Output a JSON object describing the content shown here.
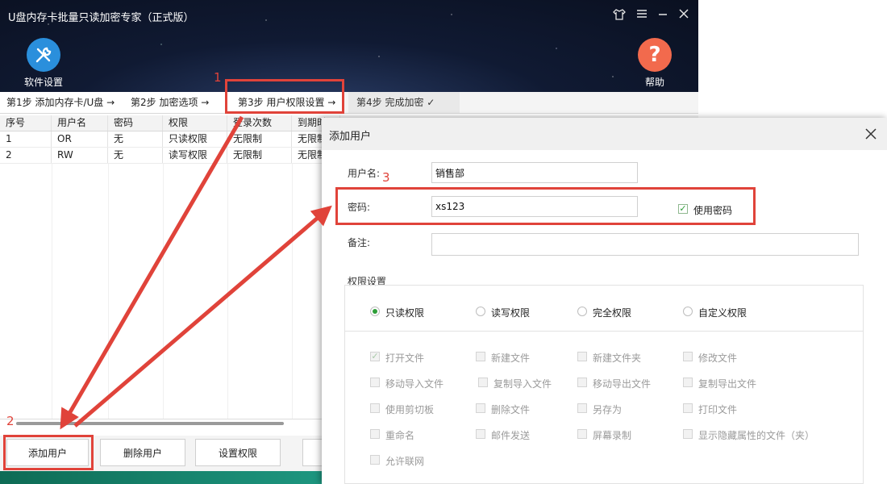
{
  "app": {
    "title": "U盘内存卡批量只读加密专家（正式版）",
    "window_buttons": [
      "skin-icon",
      "menu-icon",
      "minimize-icon",
      "close-icon"
    ]
  },
  "toolbar": {
    "settings_label": "软件设置",
    "settings_icon": "wrench-screwdriver-icon",
    "help_label": "帮助",
    "help_icon": "question-icon",
    "settings_color": "#2a8fdc",
    "help_color": "#f26a4d"
  },
  "steps": [
    {
      "label": "第1步 添加内存卡/U盘 →"
    },
    {
      "label": "第2步 加密选项 →"
    },
    {
      "label": "第3步 用户权限设置 →"
    },
    {
      "label": "第4步 完成加密 ✓"
    }
  ],
  "table": {
    "headers": [
      "序号",
      "用户名",
      "密码",
      "权限",
      "登录次数",
      "到期时"
    ],
    "rows": [
      [
        "1",
        "OR",
        "无",
        "只读权限",
        "无限制",
        "无限制"
      ],
      [
        "2",
        "RW",
        "无",
        "读写权限",
        "无限制",
        "无限制"
      ]
    ]
  },
  "buttons": {
    "add_user": "添加用户",
    "delete_user": "删除用户",
    "set_permission": "设置权限"
  },
  "dialog": {
    "title": "添加用户",
    "username_label": "用户名:",
    "username_value": "销售部",
    "password_label": "密码:",
    "password_value": "xs123",
    "use_password_label": "使用密码",
    "use_password_checked": true,
    "note_label": "备注:",
    "note_value": "",
    "permission_section": "权限设置",
    "permission_options": [
      {
        "label": "只读权限",
        "selected": true
      },
      {
        "label": "读写权限",
        "selected": false
      },
      {
        "label": "完全权限",
        "selected": false
      },
      {
        "label": "自定义权限",
        "selected": false
      }
    ],
    "permission_items": [
      {
        "label": "打开文件",
        "checked": true
      },
      {
        "label": "新建文件",
        "checked": false
      },
      {
        "label": "新建文件夹",
        "checked": false
      },
      {
        "label": "修改文件",
        "checked": false
      },
      {
        "label": "移动导入文件",
        "checked": false
      },
      {
        "label": "复制导入文件",
        "checked": false
      },
      {
        "label": "移动导出文件",
        "checked": false
      },
      {
        "label": "复制导出文件",
        "checked": false
      },
      {
        "label": "使用剪切板",
        "checked": false
      },
      {
        "label": "删除文件",
        "checked": false
      },
      {
        "label": "另存为",
        "checked": false
      },
      {
        "label": "打印文件",
        "checked": false
      },
      {
        "label": "重命名",
        "checked": false
      },
      {
        "label": "邮件发送",
        "checked": false
      },
      {
        "label": "屏幕录制",
        "checked": false
      },
      {
        "label": "显示隐藏属性的文件（夹）",
        "checked": false
      },
      {
        "label": "允许联网",
        "checked": false
      }
    ]
  },
  "annotations": {
    "n1": "1",
    "n2": "2",
    "n3": "3",
    "color": "#e0433a"
  }
}
